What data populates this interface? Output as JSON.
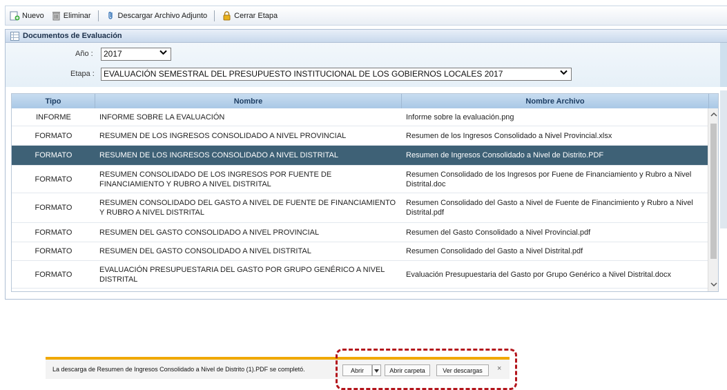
{
  "toolbar": {
    "nuevo": "Nuevo",
    "eliminar": "Eliminar",
    "descargar": "Descargar Archivo Adjunto",
    "cerrar_etapa": "Cerrar Etapa"
  },
  "panel": {
    "title": "Documentos de Evaluación",
    "anio_label": "Año :",
    "anio_value": "2017",
    "etapa_label": "Etapa :",
    "etapa_value": "EVALUACIÓN SEMESTRAL DEL PRESUPUESTO INSTITUCIONAL DE LOS GOBIERNOS LOCALES 2017"
  },
  "grid": {
    "columns": [
      "Tipo",
      "Nombre",
      "Nombre Archivo"
    ],
    "selected_index": 2,
    "rows": [
      {
        "tipo": "INFORME",
        "nombre": "INFORME SOBRE LA EVALUACIÓN",
        "archivo": "Informe sobre la evaluación.png"
      },
      {
        "tipo": "FORMATO",
        "nombre": "RESUMEN DE LOS INGRESOS CONSOLIDADO A NIVEL PROVINCIAL",
        "archivo": "Resumen de los Ingresos Consolidado a Nivel Provincial.xlsx"
      },
      {
        "tipo": "FORMATO",
        "nombre": "RESUMEN DE LOS INGRESOS CONSOLIDADO A NIVEL DISTRITAL",
        "archivo": "Resumen de Ingresos Consolidado a Nivel de Distrito.PDF"
      },
      {
        "tipo": "FORMATO",
        "nombre": "RESUMEN CONSOLIDADO DE LOS INGRESOS POR FUENTE DE FINANCIAMIENTO Y RUBRO A NIVEL DISTRITAL",
        "archivo": "Resumen Consolidado de los Ingresos por Fuene de Financiamiento y Rubro a Nivel Distrital.doc"
      },
      {
        "tipo": "FORMATO",
        "nombre": "RESUMEN CONSOLIDADO DEL GASTO A NIVEL DE FUENTE DE FINANCIAMIENTO Y RUBRO A NIVEL DISTRITAL",
        "archivo": "Resumen Consolidado del Gasto a Nivel de Fuente de Financimiento y Rubro a Nivel Distrital.pdf"
      },
      {
        "tipo": "FORMATO",
        "nombre": "RESUMEN DEL GASTO CONSOLIDADO A NIVEL PROVINCIAL",
        "archivo": "Resumen del Gasto Consolidado a Nivel Provincial.pdf"
      },
      {
        "tipo": "FORMATO",
        "nombre": "RESUMEN DEL GASTO CONSOLIDADO A NIVEL DISTRITAL",
        "archivo": "Resumen Consolidado del Gasto a Nivel Distrital.pdf"
      },
      {
        "tipo": "FORMATO",
        "nombre": "EVALUACIÓN PRESUPUESTARIA DEL GASTO POR GRUPO GENÉRICO A NIVEL DISTRITAL",
        "archivo": "Evaluación Presupuestaria del Gasto por Grupo Genérico a Nivel Distrital.docx"
      }
    ]
  },
  "download_bar": {
    "message": "La descarga de Resumen de Ingresos Consolidado a Nivel de Distrito (1).PDF se completó.",
    "abrir": "Abrir",
    "abrir_carpeta": "Abrir carpeta",
    "ver_descargas": "Ver descargas",
    "close": "×"
  },
  "colors": {
    "selected_row": "#3e6176",
    "header_text": "#1c3d63",
    "download_bar_accent": "#f0a800",
    "highlight_dash": "#b3151c"
  },
  "icons": {
    "nuevo": "new-document-icon",
    "eliminar": "trash-icon",
    "descargar": "paperclip-icon",
    "cerrar": "lock-icon",
    "panel": "grid-icon"
  }
}
